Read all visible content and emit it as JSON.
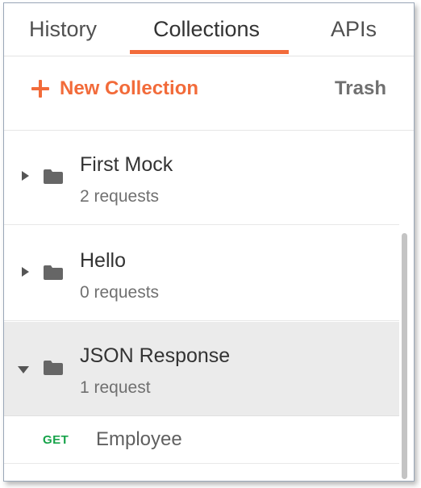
{
  "tabs": [
    {
      "label": "History",
      "active": false
    },
    {
      "label": "Collections",
      "active": true
    },
    {
      "label": "APIs",
      "active": false
    }
  ],
  "toolbar": {
    "new_collection_label": "New Collection",
    "trash_label": "Trash"
  },
  "collections": [
    {
      "name": "First Mock",
      "count": "2 requests",
      "expanded": false
    },
    {
      "name": "Hello",
      "count": "0 requests",
      "expanded": false
    },
    {
      "name": "JSON Response",
      "count": "1 request",
      "expanded": true
    }
  ],
  "requests": [
    {
      "method": "GET",
      "name": "Employee"
    }
  ],
  "colors": {
    "accent": "#f26b3a",
    "get_method": "#17a34a",
    "selected_row": "#ebebeb"
  },
  "icons": {
    "add": "plus-icon",
    "collection": "folder-icon",
    "collapsed": "caret-right-icon",
    "expanded": "caret-down-icon"
  }
}
